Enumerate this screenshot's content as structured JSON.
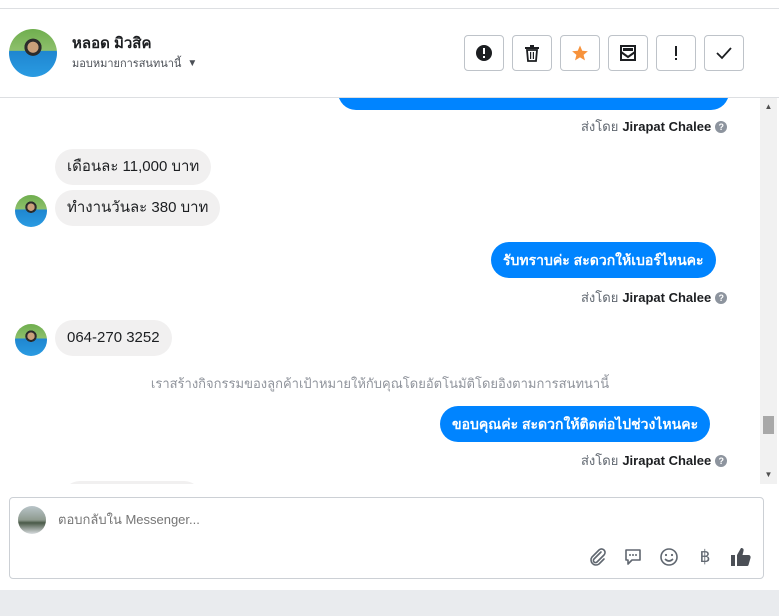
{
  "header": {
    "contact_name": "หลอด มิวสิค",
    "assign_label": "มอบหมายการสนทนานี้",
    "tools": [
      {
        "name": "report-spam-button",
        "icon": "alert-circle-icon"
      },
      {
        "name": "delete-button",
        "icon": "trash-icon"
      },
      {
        "name": "star-button",
        "icon": "star-icon",
        "color": "#f7923b"
      },
      {
        "name": "mark-unread-button",
        "icon": "envelope-icon"
      },
      {
        "name": "follow-up-button",
        "icon": "exclamation-icon"
      },
      {
        "name": "mark-done-button",
        "icon": "check-icon"
      }
    ]
  },
  "messages": {
    "sent_by_prefix": "ส่งโดย",
    "sender_name": "Jirapat Chalee",
    "in_1": "เดือนละ 11,000 บาท",
    "in_2": "ทำงานวันละ 380 บาท",
    "out_1": "รับทราบค่ะ สะดวกให้เบอร์ไหนคะ",
    "in_3": "064-270 3252",
    "system_note": "เราสร้างกิจกรรมของลูกค้าเป้าหมายให้กับคุณโดยอัตโนมัติโดยอิงตามการสนทนานี้",
    "out_2": "ขอบคุณค่ะ สะดวกให้ติดต่อไปช่วงไหนคะ"
  },
  "composer": {
    "placeholder": "ตอบกลับใน Messenger..."
  },
  "colors": {
    "accent_blue": "#0084ff",
    "star_orange": "#f7923b"
  }
}
